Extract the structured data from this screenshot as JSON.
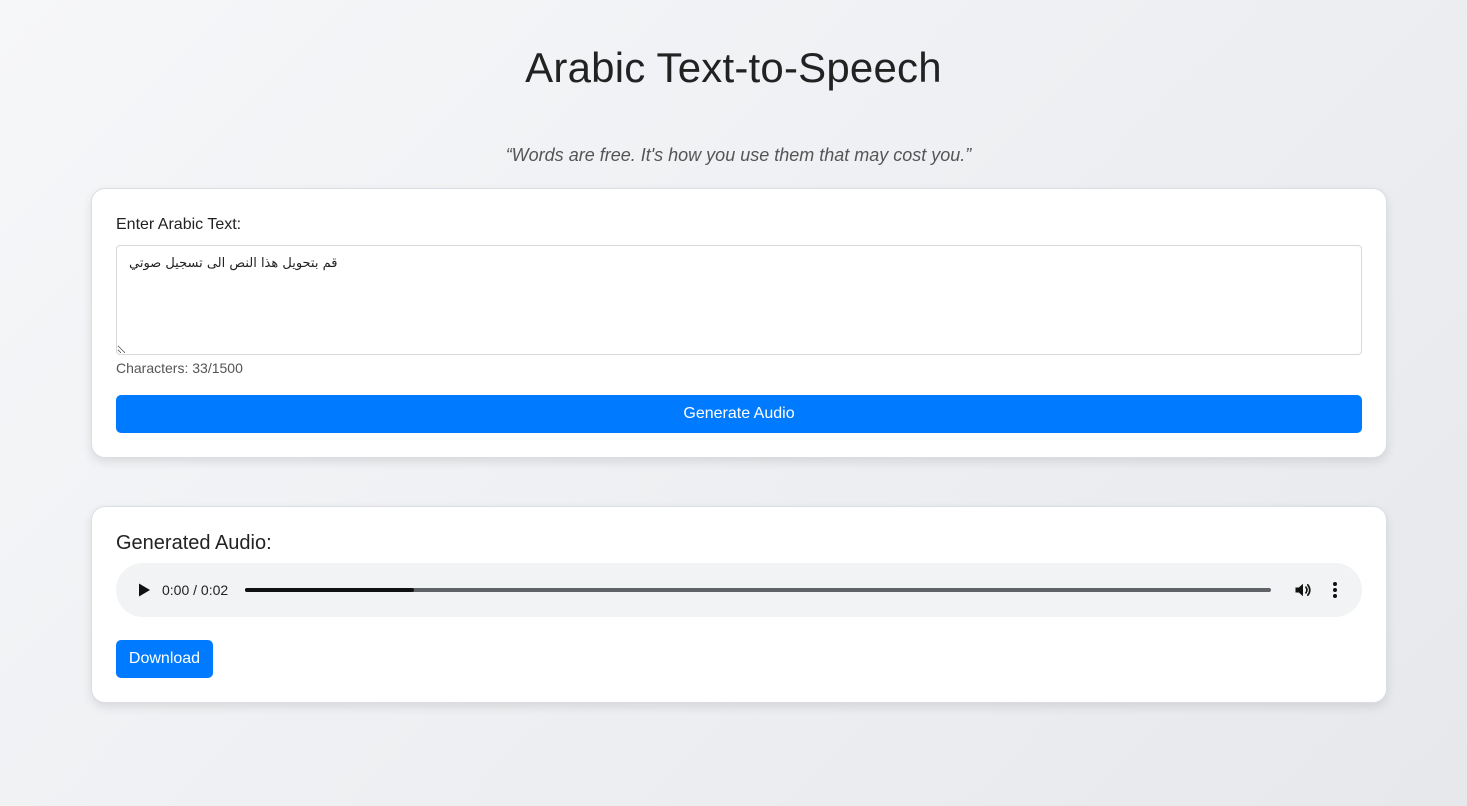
{
  "page": {
    "title": "Arabic Text-to-Speech",
    "quote": "“Words are free. It's how you use them that may cost you.”"
  },
  "input_card": {
    "label": "Enter Arabic Text:",
    "text_value": "قم بتحويل هذا النص الى تسجيل صوتي",
    "char_count": "Characters: 33/1500",
    "generate_label": "Generate Audio"
  },
  "audio_card": {
    "title": "Generated Audio:",
    "player": {
      "time": "0:00 / 0:02",
      "buffered_fraction": 0.165,
      "play_icon": "play-icon",
      "volume_icon": "volume-icon",
      "more_icon": "more-vertical-icon"
    },
    "download_label": "Download"
  },
  "colors": {
    "accent": "#007bff",
    "player_bg": "#f1f3f4"
  }
}
